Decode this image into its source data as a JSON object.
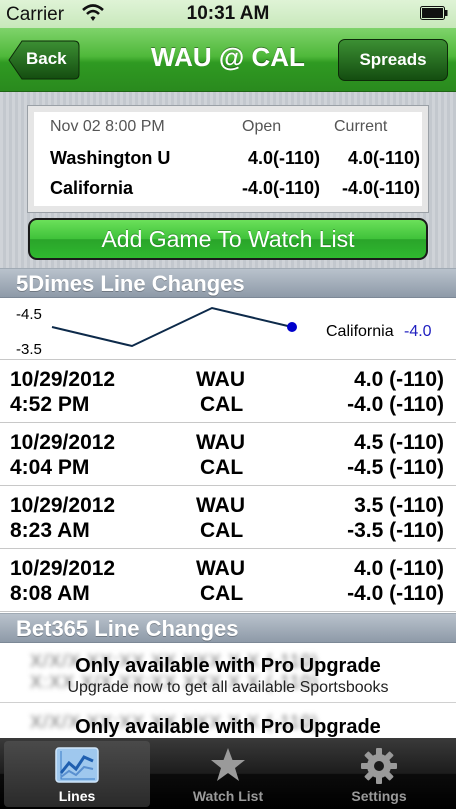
{
  "status_bar": {
    "carrier": "Carrier",
    "time": "10:31 AM"
  },
  "nav": {
    "back_label": "Back",
    "title": "WAU @ CAL",
    "spreads_label": "Spreads"
  },
  "game": {
    "datetime": "Nov 02 8:00 PM",
    "open_header": "Open",
    "current_header": "Current",
    "teams": [
      {
        "name": "Washington U",
        "open": "4.0(-110)",
        "current": "4.0(-110)"
      },
      {
        "name": "California",
        "open": "-4.0(-110)",
        "current": "-4.0(-110)"
      }
    ]
  },
  "add_watch_label": "Add Game To Watch List",
  "sections": {
    "dimes": "5Dimes Line Changes",
    "bet365": "Bet365 Line Changes"
  },
  "chart": {
    "y_top_label": "-4.5",
    "y_bottom_label": "-3.5",
    "legend_team": "California",
    "legend_value": "-4.0",
    "line_color": "#0d2a4a",
    "marker_color": "#0000cc",
    "value_color": "#2020c0"
  },
  "chart_data": {
    "type": "line",
    "series": [
      {
        "name": "California",
        "values": [
          -4.0,
          -3.5,
          -4.5,
          -4.0
        ]
      }
    ],
    "ylim": [
      -4.5,
      -3.5
    ]
  },
  "line_changes": [
    {
      "date": "10/29/2012",
      "time": "4:52 PM",
      "away": "WAU",
      "home": "CAL",
      "away_line": "4.0 (-110)",
      "home_line": "-4.0 (-110)"
    },
    {
      "date": "10/29/2012",
      "time": "4:04 PM",
      "away": "WAU",
      "home": "CAL",
      "away_line": "4.5 (-110)",
      "home_line": "-4.5 (-110)"
    },
    {
      "date": "10/29/2012",
      "time": "8:23 AM",
      "away": "WAU",
      "home": "CAL",
      "away_line": "3.5 (-110)",
      "home_line": "-3.5 (-110)"
    },
    {
      "date": "10/29/2012",
      "time": "8:08 AM",
      "away": "WAU",
      "home": "CAL",
      "away_line": "4.0 (-110)",
      "home_line": "-4.0 (-110)"
    }
  ],
  "pro_upgrade": {
    "title": "Only available with Pro Upgrade",
    "subtitle": "Upgrade now to get all available Sportsbooks"
  },
  "tabs": [
    {
      "label": "Lines",
      "icon": "chart-icon"
    },
    {
      "label": "Watch List",
      "icon": "star-icon"
    },
    {
      "label": "Settings",
      "icon": "gear-icon"
    }
  ]
}
